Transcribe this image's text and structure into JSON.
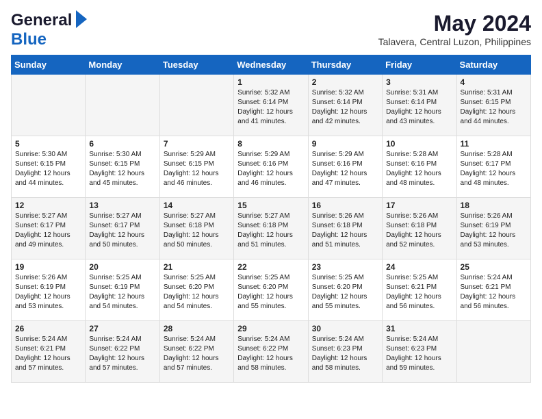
{
  "header": {
    "logo_general": "General",
    "logo_blue": "Blue",
    "main_title": "May 2024",
    "subtitle": "Talavera, Central Luzon, Philippines"
  },
  "days_of_week": [
    "Sunday",
    "Monday",
    "Tuesday",
    "Wednesday",
    "Thursday",
    "Friday",
    "Saturday"
  ],
  "weeks": [
    {
      "days": [
        {
          "num": "",
          "sunrise": "",
          "sunset": "",
          "daylight": ""
        },
        {
          "num": "",
          "sunrise": "",
          "sunset": "",
          "daylight": ""
        },
        {
          "num": "",
          "sunrise": "",
          "sunset": "",
          "daylight": ""
        },
        {
          "num": "1",
          "sunrise": "Sunrise: 5:32 AM",
          "sunset": "Sunset: 6:14 PM",
          "daylight": "Daylight: 12 hours and 41 minutes."
        },
        {
          "num": "2",
          "sunrise": "Sunrise: 5:32 AM",
          "sunset": "Sunset: 6:14 PM",
          "daylight": "Daylight: 12 hours and 42 minutes."
        },
        {
          "num": "3",
          "sunrise": "Sunrise: 5:31 AM",
          "sunset": "Sunset: 6:14 PM",
          "daylight": "Daylight: 12 hours and 43 minutes."
        },
        {
          "num": "4",
          "sunrise": "Sunrise: 5:31 AM",
          "sunset": "Sunset: 6:15 PM",
          "daylight": "Daylight: 12 hours and 44 minutes."
        }
      ]
    },
    {
      "days": [
        {
          "num": "5",
          "sunrise": "Sunrise: 5:30 AM",
          "sunset": "Sunset: 6:15 PM",
          "daylight": "Daylight: 12 hours and 44 minutes."
        },
        {
          "num": "6",
          "sunrise": "Sunrise: 5:30 AM",
          "sunset": "Sunset: 6:15 PM",
          "daylight": "Daylight: 12 hours and 45 minutes."
        },
        {
          "num": "7",
          "sunrise": "Sunrise: 5:29 AM",
          "sunset": "Sunset: 6:15 PM",
          "daylight": "Daylight: 12 hours and 46 minutes."
        },
        {
          "num": "8",
          "sunrise": "Sunrise: 5:29 AM",
          "sunset": "Sunset: 6:16 PM",
          "daylight": "Daylight: 12 hours and 46 minutes."
        },
        {
          "num": "9",
          "sunrise": "Sunrise: 5:29 AM",
          "sunset": "Sunset: 6:16 PM",
          "daylight": "Daylight: 12 hours and 47 minutes."
        },
        {
          "num": "10",
          "sunrise": "Sunrise: 5:28 AM",
          "sunset": "Sunset: 6:16 PM",
          "daylight": "Daylight: 12 hours and 48 minutes."
        },
        {
          "num": "11",
          "sunrise": "Sunrise: 5:28 AM",
          "sunset": "Sunset: 6:17 PM",
          "daylight": "Daylight: 12 hours and 48 minutes."
        }
      ]
    },
    {
      "days": [
        {
          "num": "12",
          "sunrise": "Sunrise: 5:27 AM",
          "sunset": "Sunset: 6:17 PM",
          "daylight": "Daylight: 12 hours and 49 minutes."
        },
        {
          "num": "13",
          "sunrise": "Sunrise: 5:27 AM",
          "sunset": "Sunset: 6:17 PM",
          "daylight": "Daylight: 12 hours and 50 minutes."
        },
        {
          "num": "14",
          "sunrise": "Sunrise: 5:27 AM",
          "sunset": "Sunset: 6:18 PM",
          "daylight": "Daylight: 12 hours and 50 minutes."
        },
        {
          "num": "15",
          "sunrise": "Sunrise: 5:27 AM",
          "sunset": "Sunset: 6:18 PM",
          "daylight": "Daylight: 12 hours and 51 minutes."
        },
        {
          "num": "16",
          "sunrise": "Sunrise: 5:26 AM",
          "sunset": "Sunset: 6:18 PM",
          "daylight": "Daylight: 12 hours and 51 minutes."
        },
        {
          "num": "17",
          "sunrise": "Sunrise: 5:26 AM",
          "sunset": "Sunset: 6:18 PM",
          "daylight": "Daylight: 12 hours and 52 minutes."
        },
        {
          "num": "18",
          "sunrise": "Sunrise: 5:26 AM",
          "sunset": "Sunset: 6:19 PM",
          "daylight": "Daylight: 12 hours and 53 minutes."
        }
      ]
    },
    {
      "days": [
        {
          "num": "19",
          "sunrise": "Sunrise: 5:26 AM",
          "sunset": "Sunset: 6:19 PM",
          "daylight": "Daylight: 12 hours and 53 minutes."
        },
        {
          "num": "20",
          "sunrise": "Sunrise: 5:25 AM",
          "sunset": "Sunset: 6:19 PM",
          "daylight": "Daylight: 12 hours and 54 minutes."
        },
        {
          "num": "21",
          "sunrise": "Sunrise: 5:25 AM",
          "sunset": "Sunset: 6:20 PM",
          "daylight": "Daylight: 12 hours and 54 minutes."
        },
        {
          "num": "22",
          "sunrise": "Sunrise: 5:25 AM",
          "sunset": "Sunset: 6:20 PM",
          "daylight": "Daylight: 12 hours and 55 minutes."
        },
        {
          "num": "23",
          "sunrise": "Sunrise: 5:25 AM",
          "sunset": "Sunset: 6:20 PM",
          "daylight": "Daylight: 12 hours and 55 minutes."
        },
        {
          "num": "24",
          "sunrise": "Sunrise: 5:25 AM",
          "sunset": "Sunset: 6:21 PM",
          "daylight": "Daylight: 12 hours and 56 minutes."
        },
        {
          "num": "25",
          "sunrise": "Sunrise: 5:24 AM",
          "sunset": "Sunset: 6:21 PM",
          "daylight": "Daylight: 12 hours and 56 minutes."
        }
      ]
    },
    {
      "days": [
        {
          "num": "26",
          "sunrise": "Sunrise: 5:24 AM",
          "sunset": "Sunset: 6:21 PM",
          "daylight": "Daylight: 12 hours and 57 minutes."
        },
        {
          "num": "27",
          "sunrise": "Sunrise: 5:24 AM",
          "sunset": "Sunset: 6:22 PM",
          "daylight": "Daylight: 12 hours and 57 minutes."
        },
        {
          "num": "28",
          "sunrise": "Sunrise: 5:24 AM",
          "sunset": "Sunset: 6:22 PM",
          "daylight": "Daylight: 12 hours and 57 minutes."
        },
        {
          "num": "29",
          "sunrise": "Sunrise: 5:24 AM",
          "sunset": "Sunset: 6:22 PM",
          "daylight": "Daylight: 12 hours and 58 minutes."
        },
        {
          "num": "30",
          "sunrise": "Sunrise: 5:24 AM",
          "sunset": "Sunset: 6:23 PM",
          "daylight": "Daylight: 12 hours and 58 minutes."
        },
        {
          "num": "31",
          "sunrise": "Sunrise: 5:24 AM",
          "sunset": "Sunset: 6:23 PM",
          "daylight": "Daylight: 12 hours and 59 minutes."
        },
        {
          "num": "",
          "sunrise": "",
          "sunset": "",
          "daylight": ""
        }
      ]
    }
  ]
}
